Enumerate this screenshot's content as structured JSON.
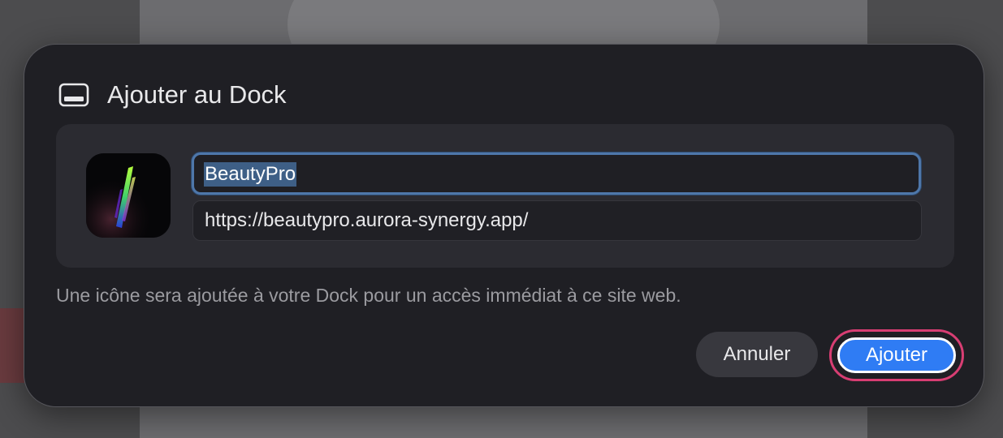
{
  "dialog": {
    "title": "Ajouter au Dock",
    "title_icon": "dock-window-icon",
    "app_icon": "beautypro-app-icon",
    "name_value": "BeautyPro",
    "url_value": "https://beautypro.aurora-synergy.app/",
    "description": "Une icône sera ajoutée à votre Dock pour un accès immédiat à ce site web.",
    "cancel_label": "Annuler",
    "add_label": "Ajouter"
  },
  "colors": {
    "dialog_background": "#1f1f24",
    "card_background": "#2b2b31",
    "focus_ring": "#4e77aa",
    "primary_button": "#2f7cf4",
    "highlight_ring": "#d83e73",
    "text_primary": "#e8e8ea",
    "text_secondary": "#9b9ba0"
  }
}
